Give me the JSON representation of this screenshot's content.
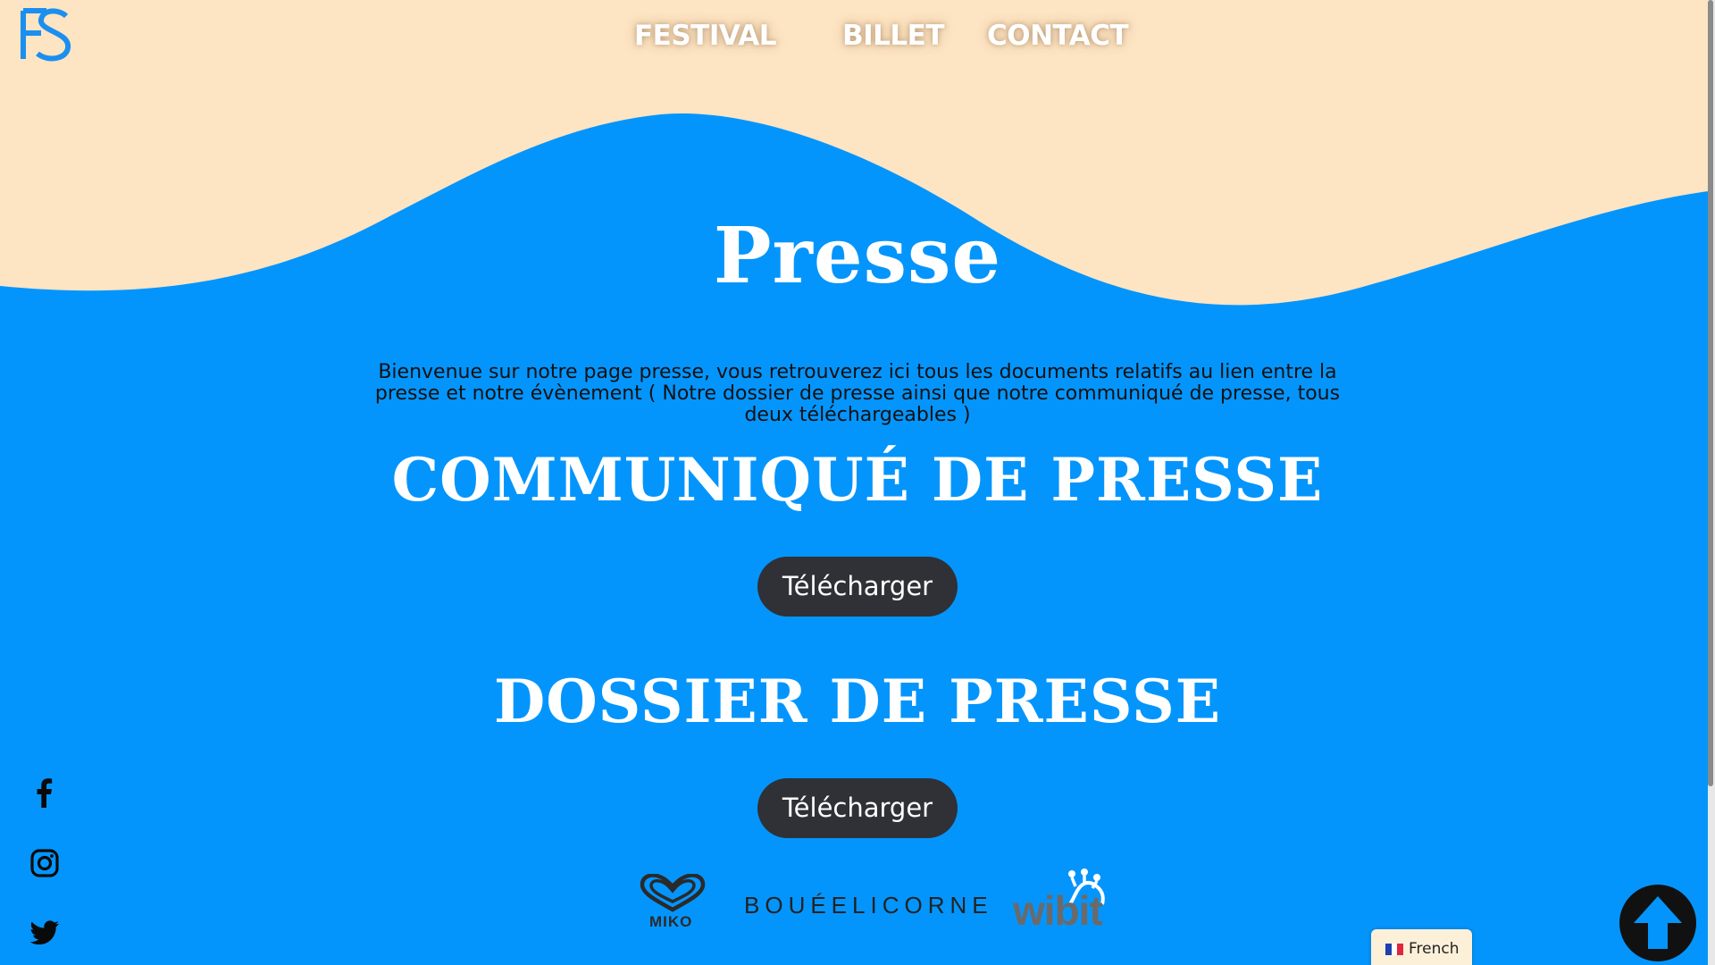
{
  "colors": {
    "background_blue": "#0495fc",
    "sand": "#fde4c2",
    "button_dark": "#2f3136",
    "logo_blue": "#1a8ff0"
  },
  "header": {
    "logo_icon": "fs-logo-icon",
    "nav": [
      {
        "label": "FESTIVAL"
      },
      {
        "label": "BILLET"
      },
      {
        "label": "CONTACT"
      }
    ]
  },
  "main": {
    "title": "Presse",
    "intro": "Bienvenue sur notre page presse, vous retrouverez ici tous les documents relatifs au lien entre la presse et notre évènement ( Notre dossier de presse ainsi que notre communiqué de presse, tous deux téléchargeables )",
    "sections": [
      {
        "heading": "COMMUNIQUÉ DE PRESSE",
        "button_label": "Télécharger"
      },
      {
        "heading": "DOSSIER DE PRESSE",
        "button_label": "Télécharger"
      }
    ]
  },
  "social": [
    {
      "icon": "facebook-icon"
    },
    {
      "icon": "instagram-icon"
    },
    {
      "icon": "twitter-icon"
    }
  ],
  "sponsors": [
    {
      "name": "MIKO"
    },
    {
      "name": "BOUÉELICORNE"
    },
    {
      "name": "wibit"
    }
  ],
  "language_switcher": {
    "label": "French",
    "icon": "flag-fr-icon"
  },
  "scroll_top": {
    "icon": "arrow-up-icon"
  }
}
